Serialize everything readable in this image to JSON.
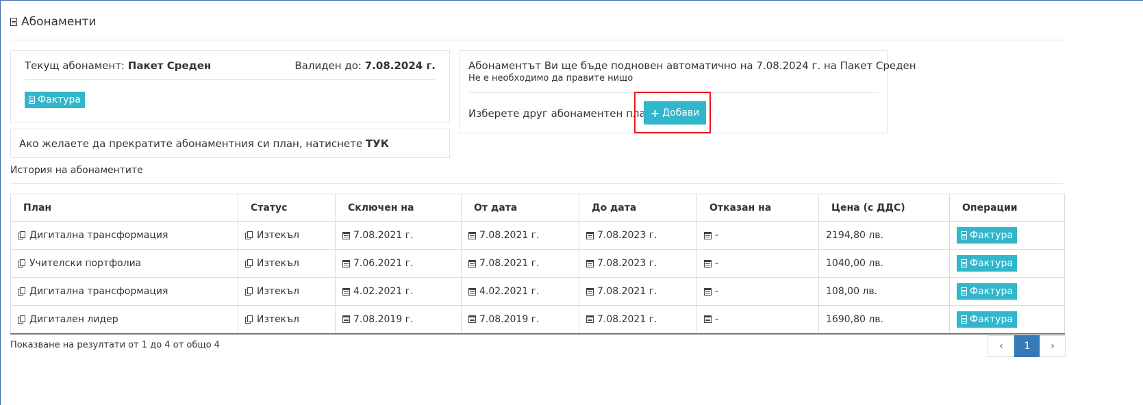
{
  "page": {
    "title": "Абонаменти"
  },
  "current": {
    "label": "Текущ абонамент:",
    "plan": "Пакет Среден",
    "valid_label": "Валиден до:",
    "valid_date": "7.08.2024 г.",
    "invoice_label": "Фактура"
  },
  "cancel": {
    "text": "Ако желаете да прекратите абонаментния си план, натиснете",
    "link": "ТУК"
  },
  "renewal": {
    "text": "Абонаментът Ви ще бъде подновен автоматично на 7.08.2024 г. на Пакет Среден",
    "subtext": "Не е необходимо да правите нищо",
    "choose_text": "Изберете друг абонаментен план",
    "add_label": "Добави"
  },
  "history": {
    "title": "История на абонаментите",
    "columns": [
      "План",
      "Статус",
      "Сключен на",
      "От дата",
      "До дата",
      "Отказан на",
      "Цена (с ДДС)",
      "Операции"
    ],
    "rows": [
      {
        "plan": "Дигитална трансформация",
        "status": "Изтекъл",
        "signed": "7.08.2021 г.",
        "from": "7.08.2021 г.",
        "to": "7.08.2023 г.",
        "cancelled": "-",
        "price": "2194,80 лв.",
        "action": "Фактура"
      },
      {
        "plan": "Учителски портфолиа",
        "status": "Изтекъл",
        "signed": "7.06.2021 г.",
        "from": "7.08.2021 г.",
        "to": "7.08.2023 г.",
        "cancelled": "-",
        "price": "1040,00 лв.",
        "action": "Фактура"
      },
      {
        "plan": "Дигитална трансформация",
        "status": "Изтекъл",
        "signed": "4.02.2021 г.",
        "from": "4.02.2021 г.",
        "to": "7.08.2021 г.",
        "cancelled": "-",
        "price": "108,00 лв.",
        "action": "Фактура"
      },
      {
        "plan": "Дигитален лидер",
        "status": "Изтекъл",
        "signed": "7.08.2019 г.",
        "from": "7.08.2019 г.",
        "to": "7.08.2021 г.",
        "cancelled": "-",
        "price": "1690,80 лв.",
        "action": "Фактура"
      }
    ]
  },
  "pagination": {
    "summary": "Показване на резултати от 1 до 4 от общо 4",
    "prev": "‹",
    "current_page": "1",
    "next": "›"
  },
  "colors": {
    "accent": "#31b6cb",
    "pager_active": "#337ab7",
    "highlight": "#e8141c"
  }
}
